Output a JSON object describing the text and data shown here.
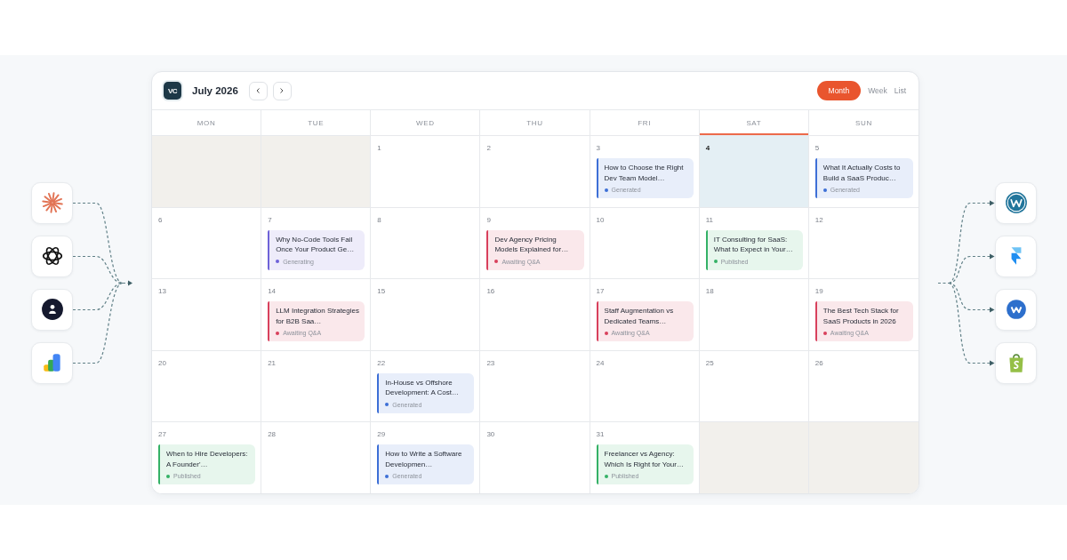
{
  "calendar": {
    "logo": "VC",
    "title": "July 2026",
    "view_tabs": [
      {
        "label": "Month",
        "selected": true
      },
      {
        "label": "Week",
        "selected": false
      },
      {
        "label": "List",
        "selected": false
      }
    ],
    "weekdays": [
      {
        "label": "MON",
        "today": false
      },
      {
        "label": "TUE",
        "today": false
      },
      {
        "label": "WED",
        "today": false
      },
      {
        "label": "THU",
        "today": false
      },
      {
        "label": "FRI",
        "today": false
      },
      {
        "label": "SAT",
        "today": true
      },
      {
        "label": "SUN",
        "today": false
      }
    ],
    "weeks": [
      {
        "days": [
          {
            "kind": "outside",
            "today": false
          },
          {
            "kind": "outside",
            "today": false
          },
          {
            "kind": "day",
            "day": "1",
            "today": false
          },
          {
            "kind": "day",
            "day": "2",
            "today": false
          },
          {
            "kind": "day",
            "day": "3",
            "today": false,
            "events": [
              {
                "title": "How to Choose the Right Dev Team Model…",
                "status": "Generated",
                "color": "#3d6fd6"
              }
            ]
          },
          {
            "kind": "day",
            "day": "4",
            "today": true
          },
          {
            "kind": "day",
            "day": "5",
            "today": false,
            "events": [
              {
                "title": "What It Actually Costs to Build a SaaS Produc…",
                "status": "Generated",
                "color": "#3d6fd6"
              }
            ]
          }
        ]
      },
      {
        "days": [
          {
            "kind": "day",
            "day": "6",
            "today": false
          },
          {
            "kind": "day",
            "day": "7",
            "today": false,
            "events": [
              {
                "title": "Why No-Code Tools Fail Once Your Product Ge…",
                "status": "Generating",
                "color": "#6e62d8"
              }
            ]
          },
          {
            "kind": "day",
            "day": "8",
            "today": false
          },
          {
            "kind": "day",
            "day": "9",
            "today": false,
            "events": [
              {
                "title": "Dev Agency Pricing Models Explained for…",
                "status": "Awaiting Q&A",
                "color": "#d8405c"
              }
            ]
          },
          {
            "kind": "day",
            "day": "10",
            "today": false
          },
          {
            "kind": "day",
            "day": "11",
            "today": false,
            "events": [
              {
                "title": "IT Consulting for SaaS: What to Expect in Your…",
                "status": "Published",
                "color": "#34b166"
              }
            ]
          },
          {
            "kind": "day",
            "day": "12",
            "today": false
          }
        ]
      },
      {
        "days": [
          {
            "kind": "day",
            "day": "13",
            "today": false
          },
          {
            "kind": "day",
            "day": "14",
            "today": false,
            "events": [
              {
                "title": "LLM Integration Strategies for B2B Saa…",
                "status": "Awaiting Q&A",
                "color": "#d8405c"
              }
            ]
          },
          {
            "kind": "day",
            "day": "15",
            "today": false
          },
          {
            "kind": "day",
            "day": "16",
            "today": false
          },
          {
            "kind": "day",
            "day": "17",
            "today": false,
            "events": [
              {
                "title": "Staff Augmentation vs Dedicated Teams…",
                "status": "Awaiting Q&A",
                "color": "#d8405c"
              }
            ]
          },
          {
            "kind": "day",
            "day": "18",
            "today": false
          },
          {
            "kind": "day",
            "day": "19",
            "today": false,
            "events": [
              {
                "title": "The Best Tech Stack for SaaS Products in 2026",
                "status": "Awaiting Q&A",
                "color": "#d8405c"
              }
            ]
          }
        ]
      },
      {
        "days": [
          {
            "kind": "day",
            "day": "20",
            "today": false
          },
          {
            "kind": "day",
            "day": "21",
            "today": false
          },
          {
            "kind": "day",
            "day": "22",
            "today": false,
            "events": [
              {
                "title": "In-House vs Offshore Development: A Cost…",
                "status": "Generated",
                "color": "#3d6fd6"
              }
            ]
          },
          {
            "kind": "day",
            "day": "23",
            "today": false
          },
          {
            "kind": "day",
            "day": "24",
            "today": false
          },
          {
            "kind": "day",
            "day": "25",
            "today": false
          },
          {
            "kind": "day",
            "day": "26",
            "today": false
          }
        ]
      },
      {
        "days": [
          {
            "kind": "day",
            "day": "27",
            "today": false,
            "events": [
              {
                "title": "When to Hire Developers: A Founder'…",
                "status": "Published",
                "color": "#34b166"
              }
            ]
          },
          {
            "kind": "day",
            "day": "28",
            "today": false
          },
          {
            "kind": "day",
            "day": "29",
            "today": false,
            "events": [
              {
                "title": "How to Write a Software Developmen…",
                "status": "Generated",
                "color": "#3d6fd6"
              }
            ]
          },
          {
            "kind": "day",
            "day": "30",
            "today": false
          },
          {
            "kind": "day",
            "day": "31",
            "today": false,
            "events": [
              {
                "title": "Freelancer vs Agency: Which Is Right for Your…",
                "status": "Published",
                "color": "#34b166"
              }
            ]
          },
          {
            "kind": "outside",
            "today": false
          },
          {
            "kind": "outside",
            "today": false
          }
        ]
      }
    ]
  }
}
